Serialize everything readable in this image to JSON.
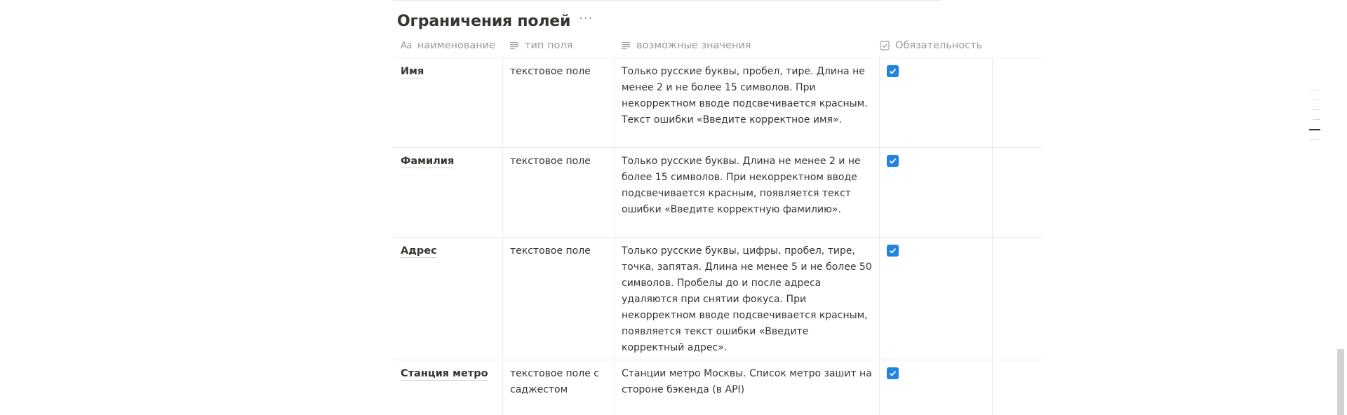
{
  "database": {
    "title": "Ограничения полей",
    "more_label": "···"
  },
  "columns": [
    {
      "icon": "title-property-icon",
      "icon_text": "Aa",
      "label": "наименование"
    },
    {
      "icon": "text-property-icon",
      "label": "тип поля"
    },
    {
      "icon": "text-property-icon",
      "label": "возможные значения"
    },
    {
      "icon": "checkbox-property-icon",
      "label": "Обязательность"
    }
  ],
  "rows": [
    {
      "name": "Имя",
      "type": "текстовое поле",
      "values": "Только русские буквы, пробел, тире. Длина не менее 2 и не более 15 символов. При некорректном вводе подсвечивается красным. Текст ошибки «Введите корректное имя».",
      "required": true
    },
    {
      "name": "Фамилия",
      "type": "текстовое поле",
      "values": "Только русские буквы. Длина не менее 2 и не более 15 символов. При некорректном вводе подсвечивается красным, появляется текст ошибки «Введите корректную фамилию».",
      "required": true
    },
    {
      "name": "Адрес",
      "type": "текстовое поле",
      "values": "Только русские буквы, цифры, пробел, тире, точка, запятая. Длина не менее 5 и не более 50 символов. Пробелы до и после адреса удаляются при снятии фокуса. При некорректном вводе подсвечивается красным, появляется текст ошибки «Введите корректный адрес».",
      "required": true
    },
    {
      "name": "Станция метро",
      "type": "текстовое поле с саджестом",
      "values": "Станции метро Москвы. Список метро зашит на стороне бэкенда (в API)",
      "required": true
    }
  ],
  "colors": {
    "checkbox_checked": "#2383e2",
    "text_primary": "#37352f",
    "text_muted": "#9b9a97",
    "border": "#ebebea"
  }
}
